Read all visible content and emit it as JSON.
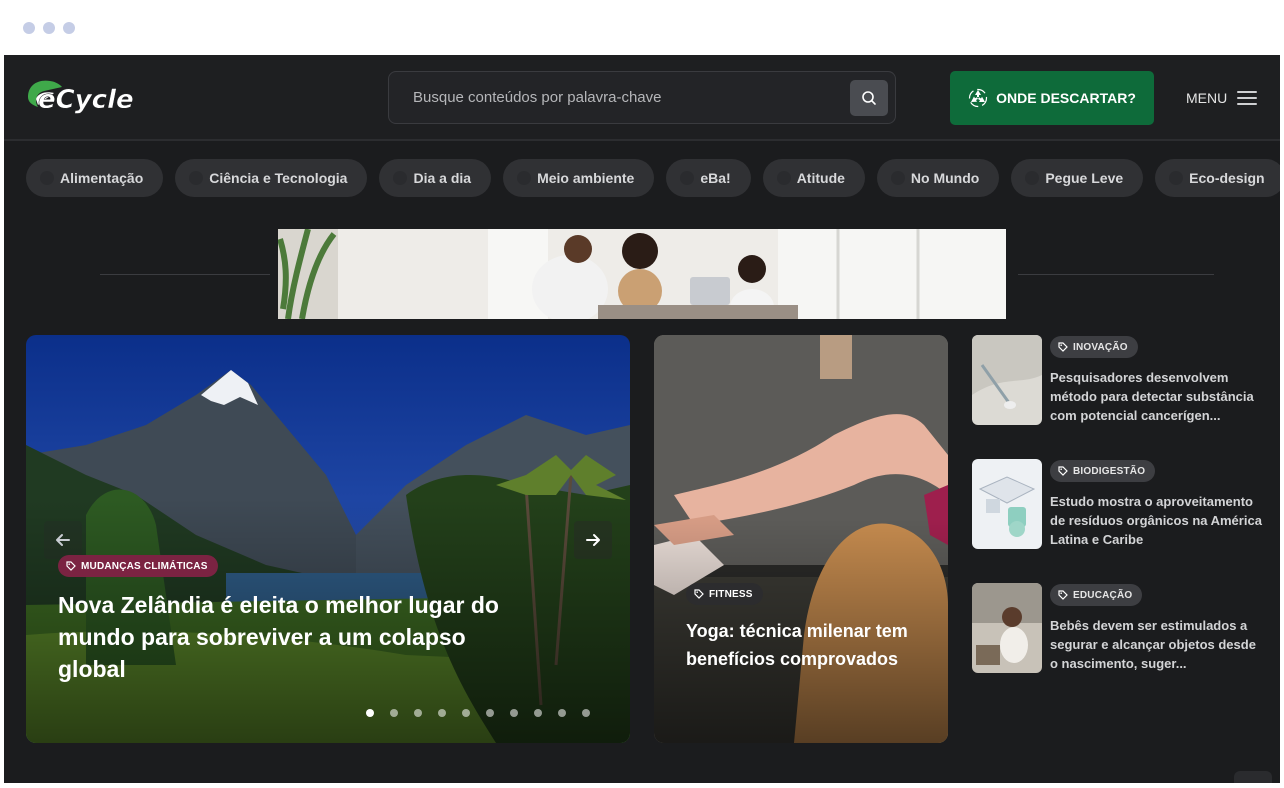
{
  "header": {
    "logo_text": "eCycle",
    "search_placeholder": "Busque conteúdos por palavra-chave",
    "cta_label": "ONDE DESCARTAR?",
    "menu_label": "MENU"
  },
  "categories": [
    "Alimentação",
    "Ciência e Tecnologia",
    "Dia a dia",
    "Meio ambiente",
    "eBa!",
    "Atitude",
    "No Mundo",
    "Pegue Leve",
    "Eco-design"
  ],
  "hero": {
    "tag": "MUDANÇAS CLIMÁTICAS",
    "title": "Nova Zelândia é eleita o melhor lugar do mundo para sobreviver a um colapso global",
    "slide_count": 10,
    "active_slide": 1
  },
  "feature": {
    "tag": "FITNESS",
    "title": "Yoga: técnica milenar tem benefícios comprovados"
  },
  "side_articles": [
    {
      "tag": "INOVAÇÃO",
      "title": "Pesquisadores desenvolvem método para detectar substância com potencial cancerígen..."
    },
    {
      "tag": "BIODIGESTÃO",
      "title": "Estudo mostra o aproveitamento de resíduos orgânicos na América Latina e Caribe"
    },
    {
      "tag": "EDUCAÇÃO",
      "title": "Bebês devem ser estimulados a segurar e alcançar objetos desde o nascimento, suger..."
    }
  ],
  "icons": {
    "search": "search-icon",
    "recycle": "recycle-icon",
    "menu": "hamburger-icon",
    "tag": "tag-icon",
    "prev": "arrow-left-icon",
    "next": "arrow-right-icon"
  },
  "colors": {
    "background": "#1b1c1e",
    "cta": "#0e6b3a",
    "hero_tag": "#7b2342",
    "pill": "#303134"
  }
}
